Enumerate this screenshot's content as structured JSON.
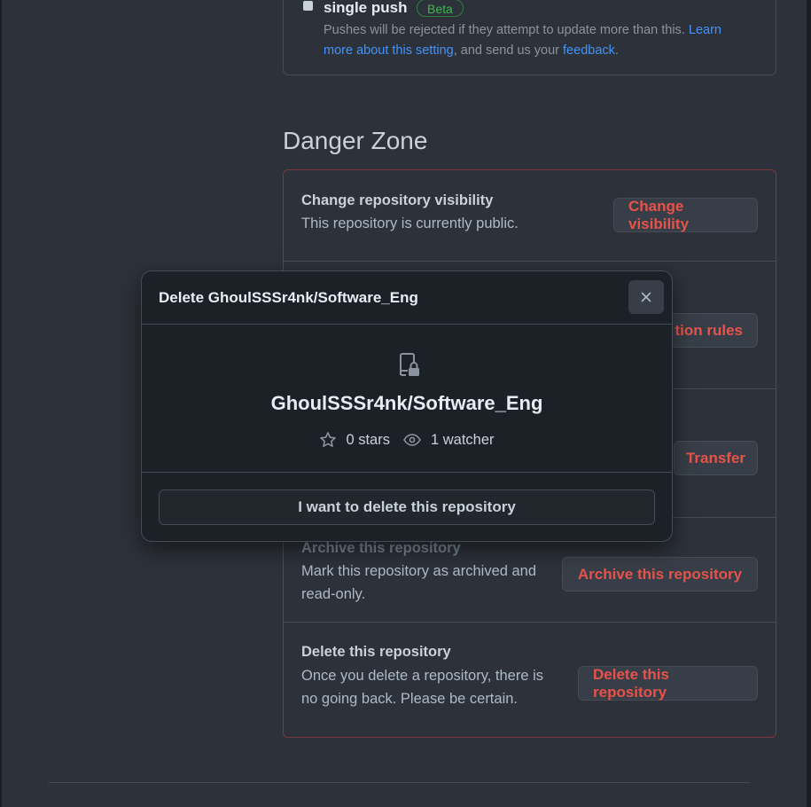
{
  "push_setting": {
    "title": "single push",
    "badge": "Beta",
    "desc_prefix": "Pushes will be rejected if they attempt to update more than this. ",
    "learn_more_link": "Learn more about this setting",
    "desc_mid": ", and send us your ",
    "feedback_link": "feedback",
    "desc_suffix": "."
  },
  "danger_zone": {
    "heading": "Danger Zone",
    "rows": [
      {
        "title": "Change repository visibility",
        "desc": "This repository is currently public.",
        "button": "Change visibility"
      },
      {
        "title": "",
        "desc": "",
        "button": "tion rules"
      },
      {
        "title": "",
        "desc": "",
        "button": "Transfer"
      },
      {
        "title": "Archive this repository",
        "desc": "Mark this repository as archived and read-only.",
        "button": "Archive this repository"
      },
      {
        "title": "Delete this repository",
        "desc": "Once you delete a repository, there is no going back. Please be certain.",
        "button": "Delete this repository"
      }
    ]
  },
  "modal": {
    "title": "Delete GhoulSSSr4nk/Software_Eng",
    "repo_name": "GhoulSSSr4nk/Software_Eng",
    "stars": "0 stars",
    "watchers": "1 watcher",
    "confirm_button": "I want to delete this repository",
    "icons": {
      "close": "x-icon",
      "repo": "repo-locked-icon",
      "star": "star-icon",
      "watch": "eye-icon"
    }
  },
  "colors": {
    "background": "#2d3139",
    "danger_text": "#e5534b",
    "danger_border": "#7c3a3f",
    "link": "#4493f8",
    "beta_green": "#3fb950"
  }
}
